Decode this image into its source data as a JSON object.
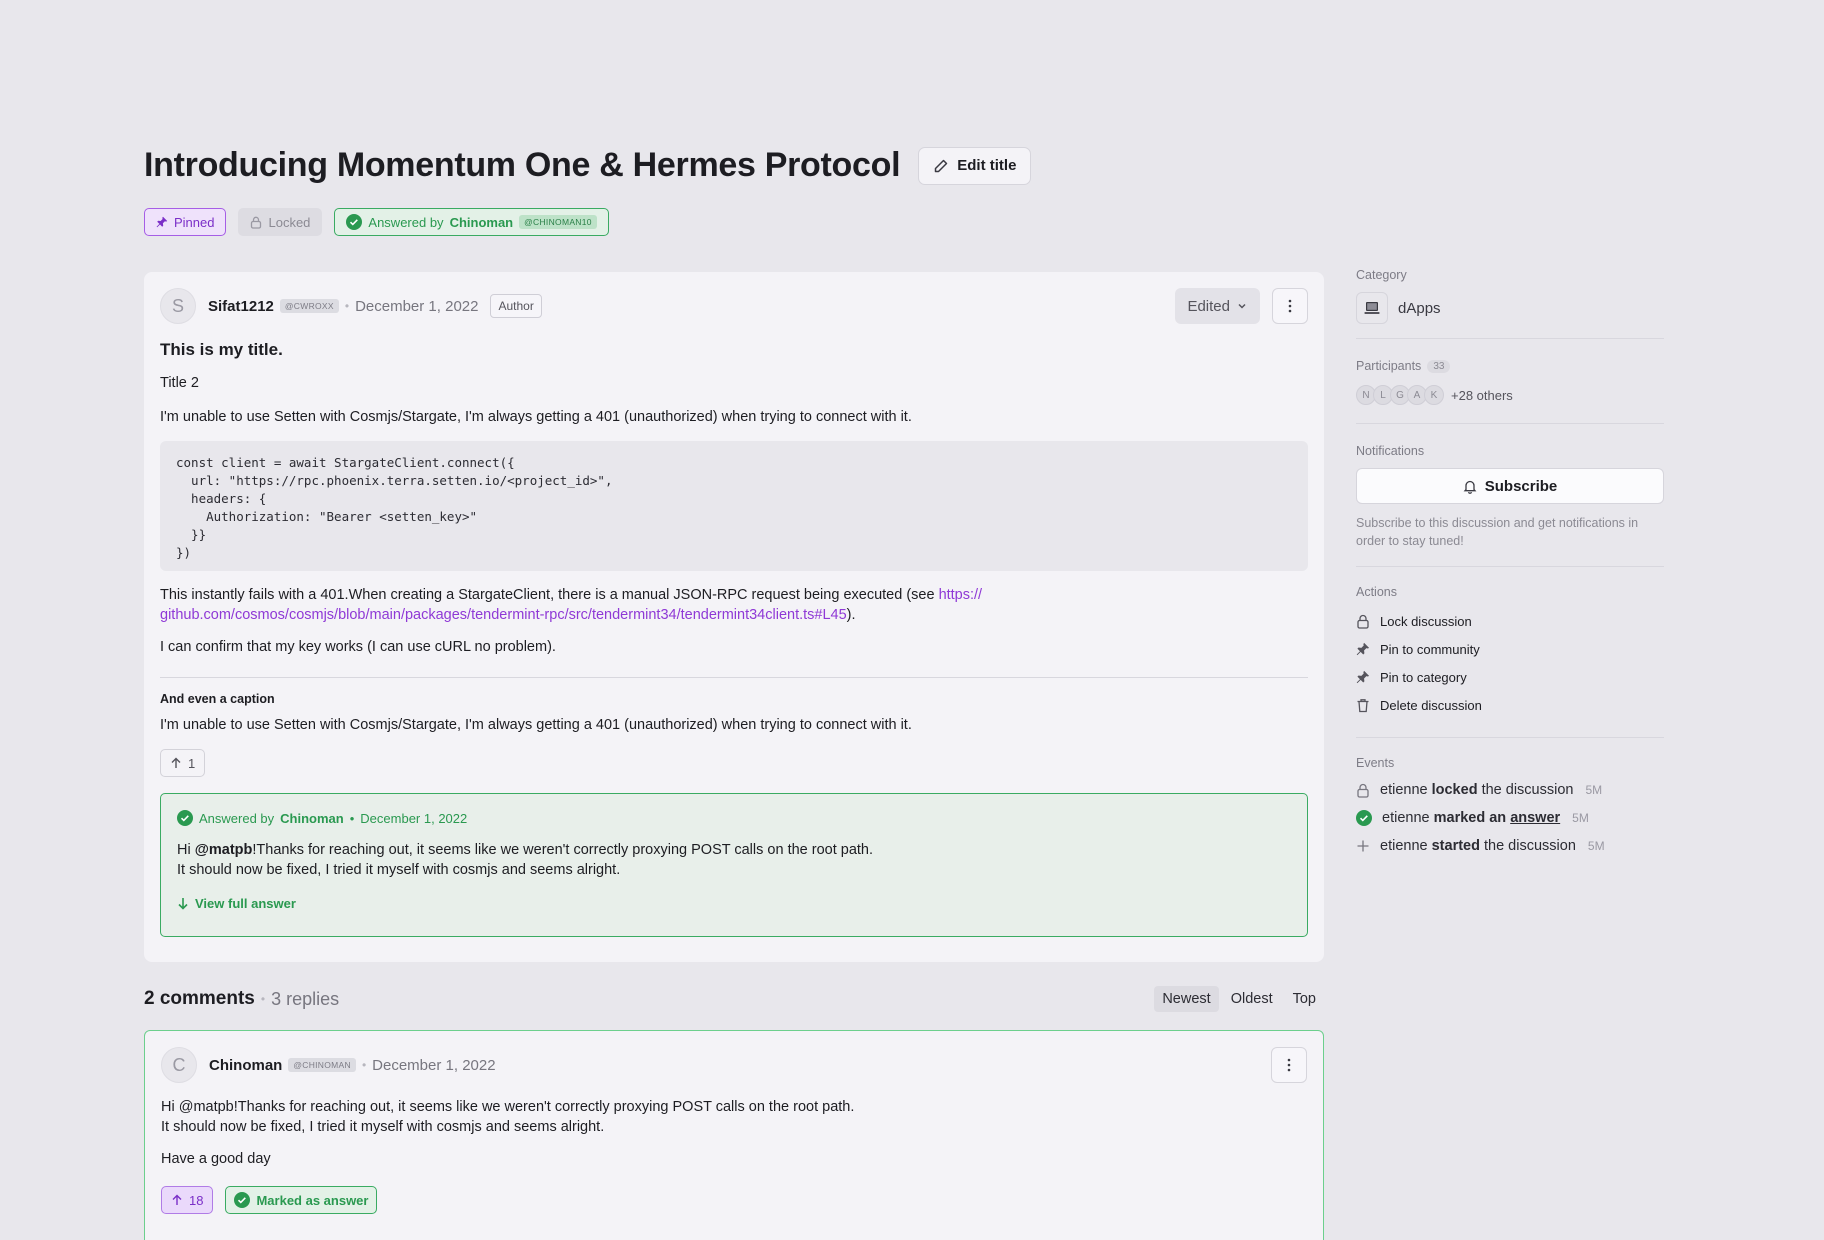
{
  "discussion": {
    "title": "Introducing Momentum One & Hermes Protocol",
    "edit_title_label": "Edit title",
    "badges": {
      "pinned": "Pinned",
      "locked": "Locked",
      "answered_prefix": "Answered by",
      "answered_by": "Chinoman",
      "answered_handle": "@CHINOMAN10"
    }
  },
  "post": {
    "author_initial": "S",
    "author": "Sifat1212",
    "handle": "@CWROXX",
    "date": "December 1, 2022",
    "author_tag": "Author",
    "edited_label": "Edited",
    "heading1": "This is my title.",
    "heading2": "Title 2",
    "para1": "I'm unable to use Setten with Cosmjs/Stargate, I'm always getting a 401 (unauthorized) when trying to connect with it.",
    "code": "const client = await StargateClient.connect({\n  url: \"https://rpc.phoenix.terra.setten.io/<project_id>\",\n  headers: {\n    Authorization: \"Bearer <setten_key>\"\n  }}\n})",
    "para2_before": "This instantly fails with a 401.When creating a StargateClient, there is a manual JSON-RPC request being executed (see ",
    "para2_link_line1": "https://",
    "para2_link_line2": "github.com/cosmos/cosmjs/blob/main/packages/tendermint-rpc/src/tendermint34/tendermint34client.ts#L45",
    "para2_after": ").",
    "para3": "I can confirm that my key works (I can use cURL no problem).",
    "caption_title": "And even a caption",
    "caption_text": "I'm unable to use Setten with Cosmjs/Stargate, I'm always getting a 401 (unauthorized) when trying to connect with it.",
    "votes": "1",
    "answer": {
      "prefix": "Answered by",
      "by": "Chinoman",
      "date": "December 1, 2022",
      "greeting": "Hi ",
      "mention": "@matpb",
      "line1_rest": "!Thanks for reaching out, it seems like we weren't correctly proxying POST calls on the root path.",
      "line2": "It should now be fixed, I tried it myself with cosmjs and seems alright.",
      "view_full": "View full answer"
    }
  },
  "comments_section": {
    "count_label": "2 comments",
    "replies_label": "3 replies",
    "sort": [
      "Newest",
      "Oldest",
      "Top"
    ],
    "active_sort": "Newest"
  },
  "comment": {
    "author_initial": "C",
    "author": "Chinoman",
    "handle": "@CHINOMAN",
    "date": "December 1, 2022",
    "line1": "Hi @matpb!Thanks for reaching out, it seems like we weren't correctly proxying POST calls on the root path.",
    "line2": "It should now be fixed, I tried it myself with cosmjs and seems alright.",
    "line3": "Have a good day",
    "votes": "18",
    "marked_label": "Marked as answer"
  },
  "sidebar": {
    "category_label": "Category",
    "category_name": "dApps",
    "participants_label": "Participants",
    "participants_count": "33",
    "participant_initials": [
      "N",
      "L",
      "G",
      "A",
      "K"
    ],
    "others_label": "+28 others",
    "notifications_label": "Notifications",
    "subscribe_label": "Subscribe",
    "subscribe_desc": "Subscribe to this discussion and get notifications in order to stay tuned!",
    "actions_label": "Actions",
    "actions": [
      "Lock discussion",
      "Pin to community",
      "Pin to category",
      "Delete discussion"
    ],
    "events_label": "Events",
    "events": [
      {
        "user": "etienne",
        "verb": "locked",
        "rest": "the discussion",
        "time": "5M"
      },
      {
        "user": "etienne",
        "verb": "marked an",
        "link": "answer",
        "time": "5M"
      },
      {
        "user": "etienne",
        "verb": "started",
        "rest": "the discussion",
        "time": "5M"
      }
    ]
  },
  "colors": {
    "accent_purple": "#8f39d6",
    "answer_green": "#2a9950",
    "background": "#e8e7ec",
    "card": "#f4f3f7"
  }
}
